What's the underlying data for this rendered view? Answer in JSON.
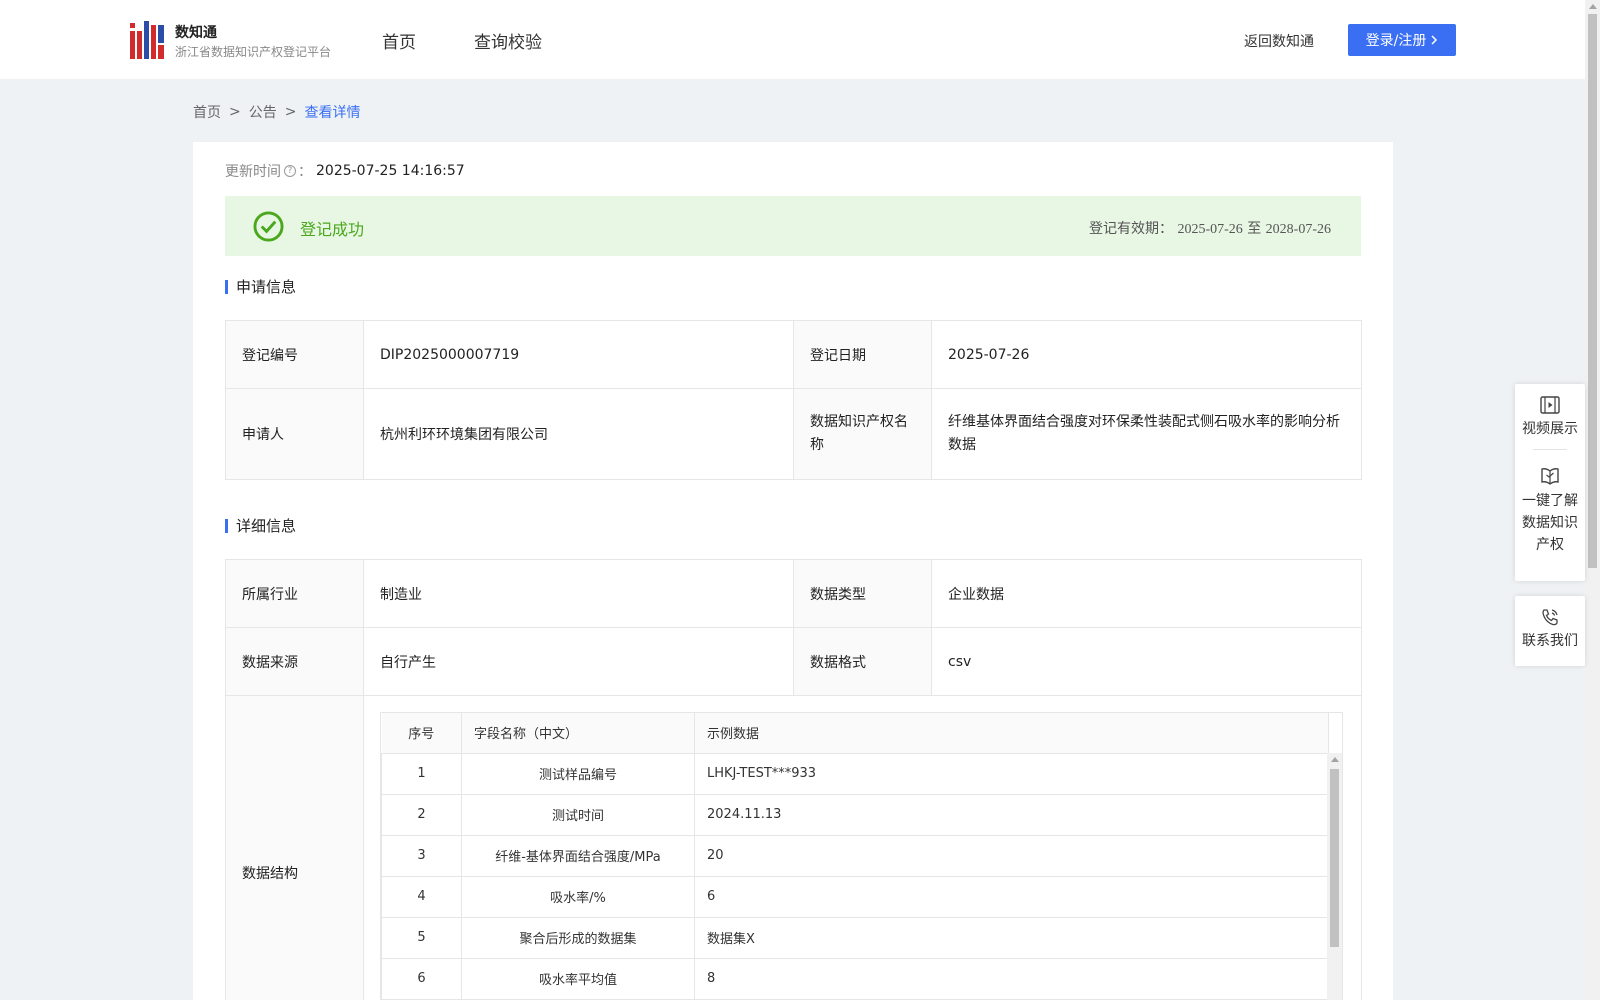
{
  "header": {
    "brand_name": "数知通",
    "brand_sub": "浙江省数据知识产权登记平台",
    "nav": [
      "首页",
      "查询校验"
    ],
    "back_link": "返回数知通",
    "login_label": "登录/注册"
  },
  "breadcrumb": [
    "首页",
    "公告",
    "查看详情"
  ],
  "update": {
    "label": "更新时间",
    "value": "2025-07-25 14:16:57"
  },
  "banner": {
    "status": "登记成功",
    "validity_label": "登记有效期：",
    "validity_start": "2025-07-26",
    "validity_sep": "至",
    "validity_end": "2028-07-26"
  },
  "apply_section": {
    "title": "申请信息",
    "reg_no_label": "登记编号",
    "reg_no": "DIP2025000007719",
    "reg_date_label": "登记日期",
    "reg_date": "2025-07-26",
    "applicant_label": "申请人",
    "applicant": "杭州利环环境集团有限公司",
    "ip_name_label": "数据知识产权名称",
    "ip_name": "纤维基体界面结合强度对环保柔性装配式侧石吸水率的影响分析数据"
  },
  "detail_section": {
    "title": "详细信息",
    "industry_label": "所属行业",
    "industry": "制造业",
    "data_type_label": "数据类型",
    "data_type": "企业数据",
    "source_label": "数据来源",
    "source": "自行产生",
    "format_label": "数据格式",
    "format": "csv",
    "structure_label": "数据结构"
  },
  "structure_table": {
    "headers": [
      "序号",
      "字段名称（中文）",
      "示例数据"
    ],
    "rows": [
      [
        "1",
        "测试样品编号",
        "LHKJ-TEST***933"
      ],
      [
        "2",
        "测试时间",
        "2024.11.13"
      ],
      [
        "3",
        "纤维-基体界面结合强度/MPa",
        "20"
      ],
      [
        "4",
        "吸水率/%",
        "6"
      ],
      [
        "5",
        "聚合后形成的数据集",
        "数据集X"
      ],
      [
        "6",
        "吸水率平均值",
        "8"
      ]
    ]
  },
  "float_panel": {
    "video": "视频展示",
    "learn": [
      "一键了解",
      "数据知识",
      "产权"
    ],
    "contact": "联系我们"
  },
  "colors": {
    "primary": "#3a6ff4",
    "success": "#4aa81c",
    "success_bg": "#e8f6e4",
    "logo_red": "#d22b2b",
    "logo_blue": "#2b4da8"
  }
}
